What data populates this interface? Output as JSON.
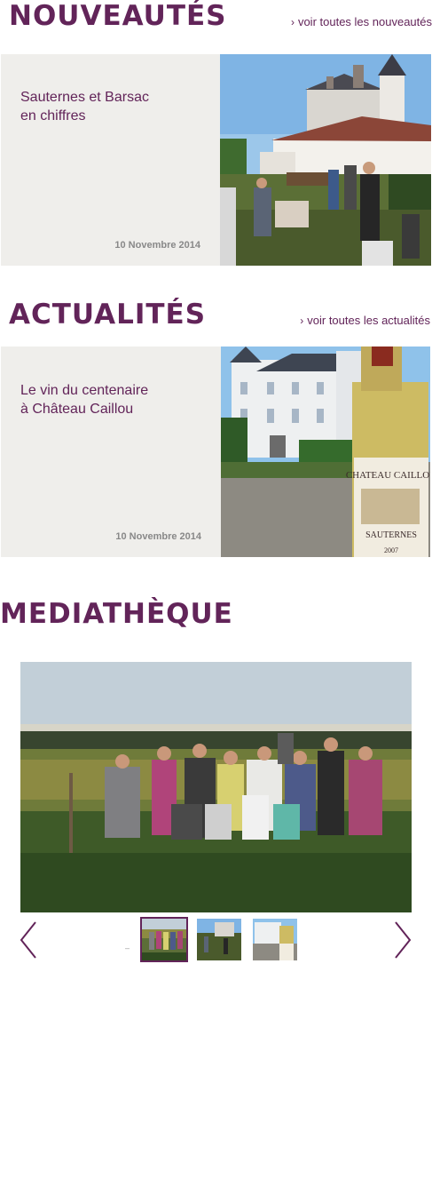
{
  "nouveautes": {
    "title": "NOUVEAUTÉS",
    "see_all": "voir toutes les nouveautés",
    "card": {
      "title_line1": "Sauternes et Barsac",
      "title_line2": "en chiffres",
      "date": "10 Novembre 2014"
    }
  },
  "actualites": {
    "title": "ACTUALITÉS",
    "see_all": "voir toutes les actualités",
    "card": {
      "title_line1": "Le vin du centenaire",
      "title_line2": "à Château Caillou",
      "date": "10 Novembre 2014",
      "bottle_label_brand": "CHATEAU CAILLOU",
      "bottle_label_region": "SAUTERNES",
      "bottle_label_year": "2007"
    }
  },
  "mediatheque": {
    "title": "MEDIATHÈQUE",
    "pager_marker": "–",
    "thumbnails": [
      "group photo in vineyard",
      "harvest workers",
      "château and bottle"
    ],
    "active_thumbnail": 0
  },
  "icons": {
    "see_all_chevron": "chevron-right-icon",
    "prev": "chevron-left-icon",
    "next": "chevron-right-icon"
  },
  "colors": {
    "brand": "#622459",
    "card_bg": "#efeeeb",
    "date_text": "#888888"
  }
}
